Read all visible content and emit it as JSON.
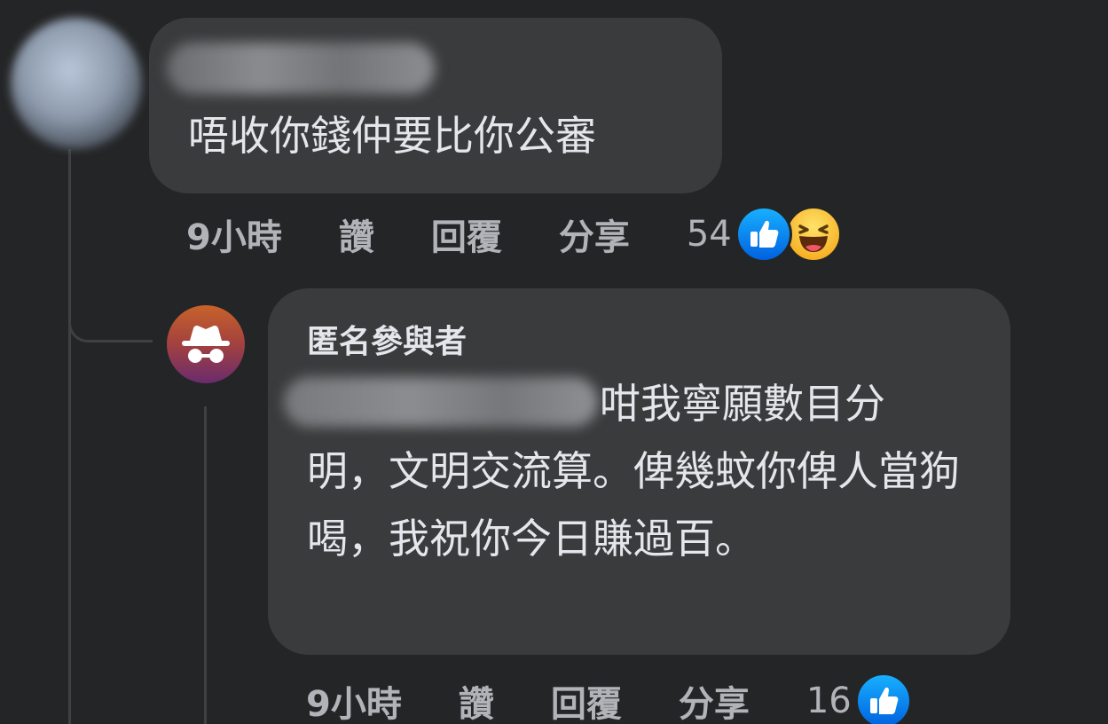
{
  "comment_1": {
    "author_name_hidden": true,
    "text": "唔收你錢仲要比你公審",
    "time": "9小時",
    "like_label": "讚",
    "reply_label": "回覆",
    "share_label": "分享",
    "reaction_count": "54",
    "reactions": [
      "like-icon",
      "haha-icon"
    ]
  },
  "comment_2": {
    "author_name": "匿名參與者",
    "text": "咁我寧願數目分明，文明交流算。俾幾蚊你俾人當狗喝，我祝你今日賺過百。",
    "time": "9小時",
    "like_label": "讚",
    "reply_label": "回覆",
    "share_label": "分享",
    "reaction_count": "16",
    "reactions": [
      "like-icon"
    ]
  },
  "colors": {
    "background": "#242526",
    "bubble": "#3a3b3c",
    "text": "#e4e6eb",
    "secondary_text": "#b0b3b8",
    "like_blue": "#1877f2"
  }
}
